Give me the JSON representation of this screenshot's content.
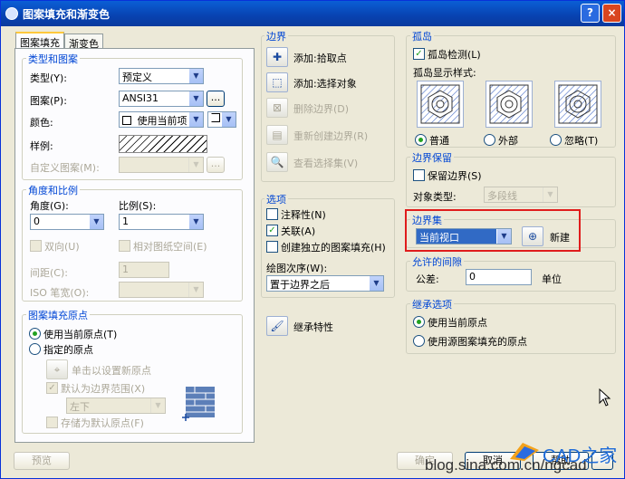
{
  "window": {
    "title": "图案填充和渐变色",
    "help_btn": "?",
    "close_btn": "×"
  },
  "tabs": [
    "图案填充",
    "渐变色"
  ],
  "type_pattern": {
    "title": "类型和图案",
    "type_label": "类型(Y):",
    "type_value": "预定义",
    "pattern_label": "图案(P):",
    "pattern_value": "ANSI31",
    "pattern_btn": "...",
    "color_label": "颜色:",
    "color_value": "使用当前项",
    "sample_label": "样例:",
    "custom_label": "自定义图案(M):",
    "custom_btn": "..."
  },
  "angle_scale": {
    "title": "角度和比例",
    "angle_label": "角度(G):",
    "angle_value": "0",
    "scale_label": "比例(S):",
    "scale_value": "1",
    "double_label": "双向(U)",
    "relative_label": "相对图纸空间(E)",
    "spacing_label": "间距(C):",
    "spacing_value": "1",
    "iso_label": "ISO 笔宽(O):"
  },
  "origin": {
    "title": "图案填充原点",
    "current_label": "使用当前原点(T)",
    "specified_label": "指定的原点",
    "click_label": "单击以设置新原点",
    "default_extent_label": "默认为边界范围(X)",
    "position_value": "左下",
    "store_label": "存储为默认原点(F)"
  },
  "boundary": {
    "title": "边界",
    "add_pick_label": "添加:拾取点",
    "add_select_label": "添加:选择对象",
    "remove_label": "删除边界(D)",
    "recreate_label": "重新创建边界(R)",
    "view_label": "查看选择集(V)"
  },
  "options": {
    "title": "选项",
    "annotative_label": "注释性(N)",
    "associative_label": "关联(A)",
    "separate_label": "创建独立的图案填充(H)",
    "draw_order_label": "绘图次序(W):",
    "draw_order_value": "置于边界之后"
  },
  "inherit": {
    "label": "继承特性"
  },
  "islands": {
    "title": "孤岛",
    "detect_label": "孤岛检测(L)",
    "style_label": "孤岛显示样式:",
    "normal_label": "普通",
    "outer_label": "外部",
    "ignore_label": "忽略(T)"
  },
  "retain": {
    "title": "边界保留",
    "retain_label": "保留边界(S)",
    "object_type_label": "对象类型:",
    "object_type_value": "多段线"
  },
  "boundary_set": {
    "title": "边界集",
    "value": "当前视口",
    "new_label": "新建"
  },
  "gap": {
    "title": "允许的间隙",
    "tolerance_label": "公差:",
    "tolerance_value": "0",
    "unit_label": "单位"
  },
  "inherit_options": {
    "title": "继承选项",
    "current_label": "使用当前原点",
    "source_label": "使用源图案填充的原点"
  },
  "footer": {
    "preview_label": "预览",
    "ok_label": "确定",
    "cancel_label": "取消",
    "help_label": "帮助",
    "watermark": "blog.sina.com.cn/ngcad",
    "logo_text": "CAD之家"
  }
}
